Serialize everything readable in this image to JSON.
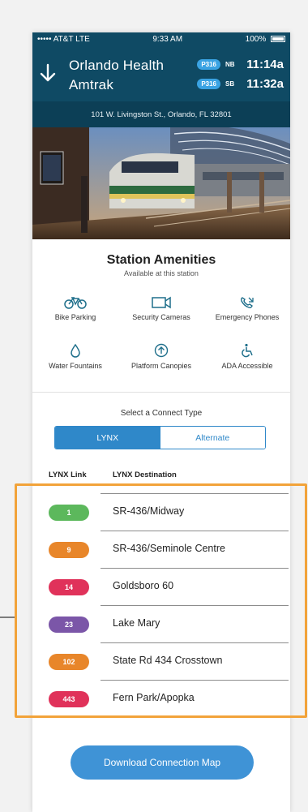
{
  "status_bar": {
    "carrier": "••••• AT&T  LTE",
    "time": "9:33 AM",
    "battery": "100%"
  },
  "header": {
    "station_name_line1": "Orlando Health",
    "station_name_line2": "Amtrak",
    "routes": [
      {
        "route": "P316",
        "direction": "NB",
        "time": "11:14a"
      },
      {
        "route": "P316",
        "direction": "SB",
        "time": "11:32a"
      }
    ]
  },
  "address": "101 W. Livingston St., Orlando, FL 32801",
  "amenities": {
    "title": "Station Amenities",
    "subtitle": "Available at this station",
    "items": [
      {
        "label": "Bike Parking",
        "icon": "bike-icon"
      },
      {
        "label": "Security Cameras",
        "icon": "camera-icon"
      },
      {
        "label": "Emergency Phones",
        "icon": "phone-icon"
      },
      {
        "label": "Water Fountains",
        "icon": "water-drop-icon"
      },
      {
        "label": "Platform Canopies",
        "icon": "canopy-icon"
      },
      {
        "label": "ADA Accessible",
        "icon": "wheelchair-icon"
      }
    ]
  },
  "connect": {
    "label": "Select a Connect Type",
    "options": [
      "LYNX",
      "Alternate"
    ],
    "selected": "LYNX"
  },
  "lynx_table": {
    "headers": [
      "LYNX Link",
      "LYNX Destination"
    ],
    "rows": [
      {
        "route": "1",
        "destination": "SR-436/Midway",
        "color": "#5cb85c"
      },
      {
        "route": "9",
        "destination": "SR-436/Seminole Centre",
        "color": "#e8862a"
      },
      {
        "route": "14",
        "destination": "Goldsboro 60",
        "color": "#e0325a"
      },
      {
        "route": "23",
        "destination": "Lake Mary",
        "color": "#7b56a8"
      },
      {
        "route": "102",
        "destination": "State Rd 434 Crosstown",
        "color": "#e8862a"
      },
      {
        "route": "443",
        "destination": "Fern Park/Apopka",
        "color": "#e0325a"
      }
    ]
  },
  "download_label": "Download Connection Map",
  "colors": {
    "header": "#0f4a64",
    "accent": "#2f88c9",
    "highlight": "#f2a33a"
  }
}
